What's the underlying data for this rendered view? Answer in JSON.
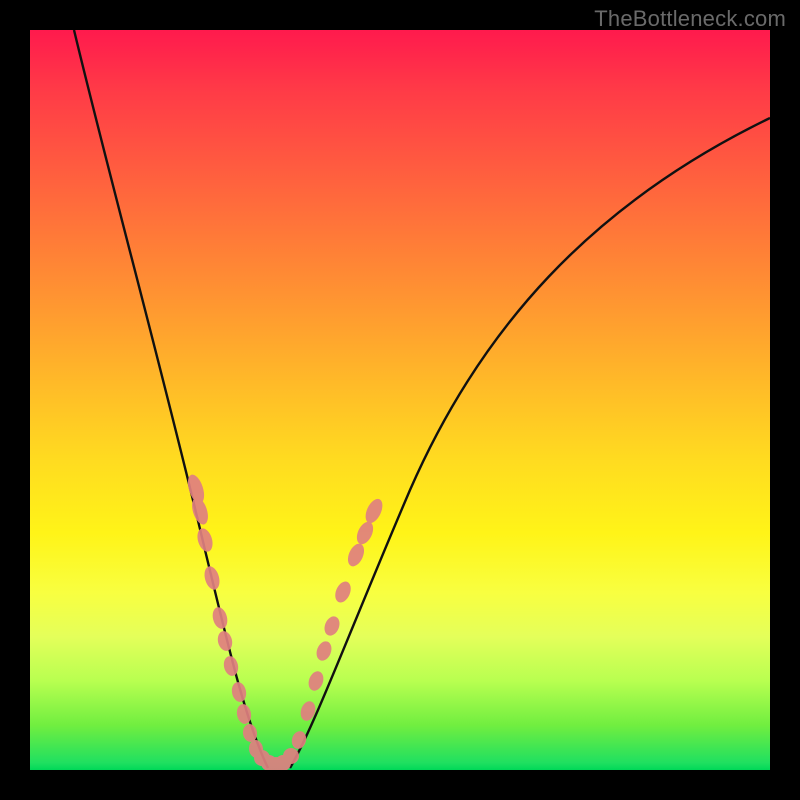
{
  "watermark": {
    "text": "TheBottleneck.com"
  },
  "colors": {
    "curve_stroke": "#111111",
    "marker_fill": "#e08080",
    "gradient_stops": [
      "#ff1a4d",
      "#ff7a38",
      "#fff418",
      "#20e060"
    ]
  },
  "chart_data": {
    "type": "line",
    "title": "",
    "xlabel": "",
    "ylabel": "",
    "xlim": [
      0,
      100
    ],
    "ylim": [
      0,
      100
    ],
    "series": [
      {
        "name": "left-branch",
        "x": [
          6,
          10,
          14,
          18,
          22,
          24,
          26,
          28,
          30,
          31.5
        ],
        "values": [
          99,
          85,
          70,
          55,
          40,
          30,
          21,
          12,
          5,
          0
        ]
      },
      {
        "name": "right-branch",
        "x": [
          35,
          37,
          40,
          44,
          50,
          58,
          68,
          80,
          92,
          100
        ],
        "values": [
          0,
          6,
          16,
          28,
          42,
          56,
          68,
          78,
          85,
          88
        ]
      }
    ],
    "markers": [
      {
        "x": 22.5,
        "y": 38
      },
      {
        "x": 23.0,
        "y": 35
      },
      {
        "x": 23.6,
        "y": 31
      },
      {
        "x": 24.6,
        "y": 26
      },
      {
        "x": 25.7,
        "y": 20.5
      },
      {
        "x": 26.3,
        "y": 17.5
      },
      {
        "x": 27.2,
        "y": 14
      },
      {
        "x": 28.2,
        "y": 10.5
      },
      {
        "x": 28.9,
        "y": 7.5
      },
      {
        "x": 29.7,
        "y": 5
      },
      {
        "x": 30.6,
        "y": 2.8
      },
      {
        "x": 31.4,
        "y": 1.5
      },
      {
        "x": 32.3,
        "y": 0.8
      },
      {
        "x": 33.2,
        "y": 0.6
      },
      {
        "x": 34.2,
        "y": 0.8
      },
      {
        "x": 35.3,
        "y": 1.8
      },
      {
        "x": 36.3,
        "y": 4
      },
      {
        "x": 37.5,
        "y": 8
      },
      {
        "x": 38.6,
        "y": 12
      },
      {
        "x": 39.7,
        "y": 16
      },
      {
        "x": 40.8,
        "y": 19.5
      },
      {
        "x": 42.3,
        "y": 24
      },
      {
        "x": 44.0,
        "y": 29
      },
      {
        "x": 45.3,
        "y": 32
      },
      {
        "x": 46.5,
        "y": 35
      }
    ]
  }
}
